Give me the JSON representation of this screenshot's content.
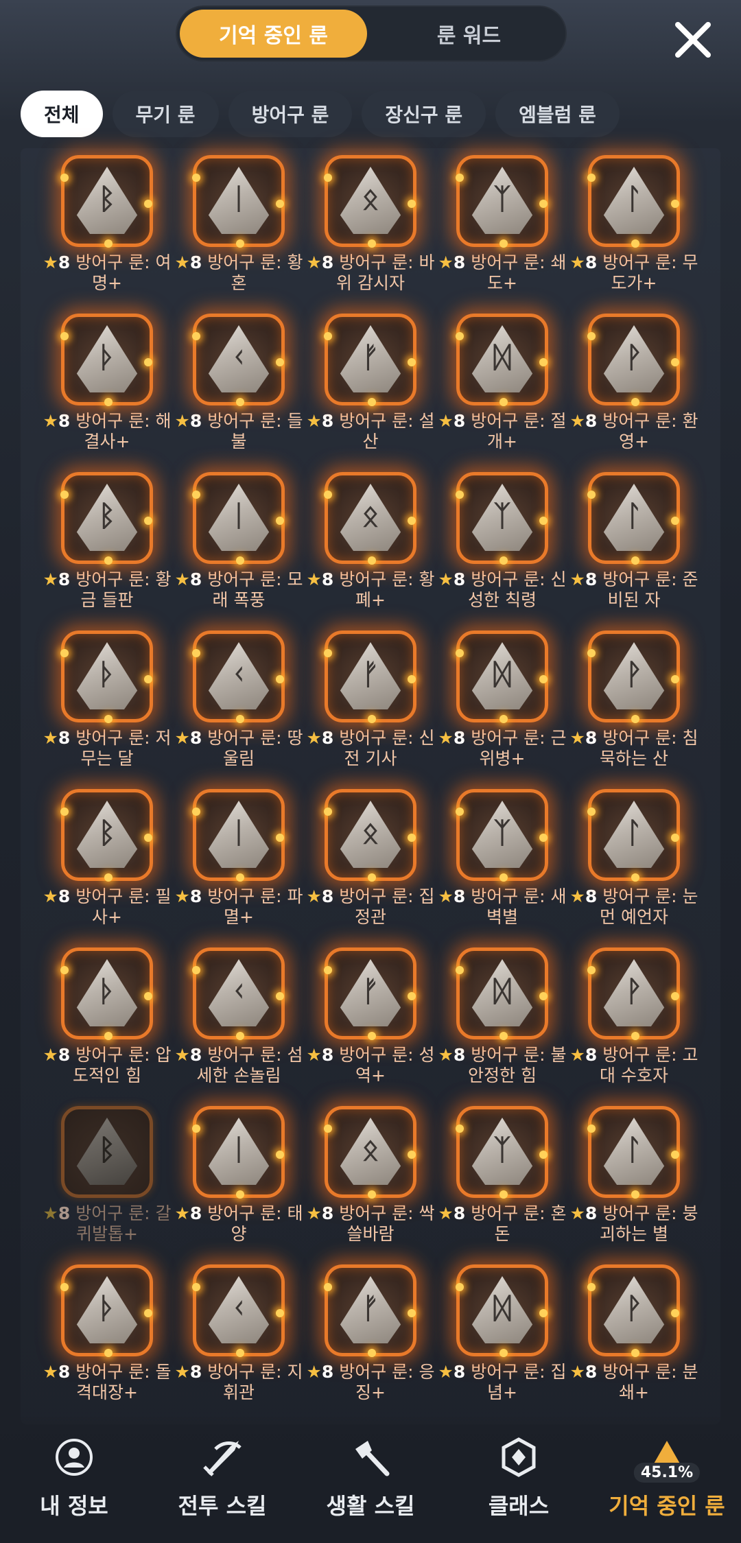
{
  "top_tabs": [
    {
      "label": "기억 중인 룬",
      "active": true
    },
    {
      "label": "룬 워드",
      "active": false
    }
  ],
  "filters": [
    {
      "label": "전체",
      "active": true
    },
    {
      "label": "무기 룬",
      "active": false
    },
    {
      "label": "방어구 룬",
      "active": false
    },
    {
      "label": "장신구 룬",
      "active": false
    },
    {
      "label": "엠블럼 룬",
      "active": false
    }
  ],
  "runes": [
    {
      "level": "8",
      "name": "방어구 룬: 여명+",
      "glyph": "ᛒ",
      "dim": false
    },
    {
      "level": "8",
      "name": "방어구 룬: 황혼",
      "glyph": "ᛁ",
      "dim": false
    },
    {
      "level": "8",
      "name": "방어구 룬: 바위 감시자",
      "glyph": "ᛟ",
      "dim": false
    },
    {
      "level": "8",
      "name": "방어구 룬: 쇄도+",
      "glyph": "ᛉ",
      "dim": false
    },
    {
      "level": "8",
      "name": "방어구 룬: 무도가+",
      "glyph": "ᛚ",
      "dim": false
    },
    {
      "level": "8",
      "name": "방어구 룬: 해결사+",
      "glyph": "ᚦ",
      "dim": false
    },
    {
      "level": "8",
      "name": "방어구 룬: 들불",
      "glyph": "ᚲ",
      "dim": false
    },
    {
      "level": "8",
      "name": "방어구 룬: 설산",
      "glyph": "ᚠ",
      "dim": false
    },
    {
      "level": "8",
      "name": "방어구 룬: 절개+",
      "glyph": "ᛞ",
      "dim": false
    },
    {
      "level": "8",
      "name": "방어구 룬: 환영+",
      "glyph": "ᚹ",
      "dim": false
    },
    {
      "level": "8",
      "name": "방어구 룬: 황금 들판",
      "glyph": "ᛒ",
      "dim": false
    },
    {
      "level": "8",
      "name": "방어구 룬: 모래 폭풍",
      "glyph": "ᛁ",
      "dim": false
    },
    {
      "level": "8",
      "name": "방어구 룬: 황폐+",
      "glyph": "ᛟ",
      "dim": false
    },
    {
      "level": "8",
      "name": "방어구 룬: 신성한 칙령",
      "glyph": "ᛉ",
      "dim": false
    },
    {
      "level": "8",
      "name": "방어구 룬: 준비된 자",
      "glyph": "ᛚ",
      "dim": false
    },
    {
      "level": "8",
      "name": "방어구 룬: 저무는 달",
      "glyph": "ᚦ",
      "dim": false
    },
    {
      "level": "8",
      "name": "방어구 룬: 땅울림",
      "glyph": "ᚲ",
      "dim": false
    },
    {
      "level": "8",
      "name": "방어구 룬: 신전 기사",
      "glyph": "ᚠ",
      "dim": false
    },
    {
      "level": "8",
      "name": "방어구 룬: 근위병+",
      "glyph": "ᛞ",
      "dim": false
    },
    {
      "level": "8",
      "name": "방어구 룬: 침묵하는 산",
      "glyph": "ᚹ",
      "dim": false
    },
    {
      "level": "8",
      "name": "방어구 룬: 필사+",
      "glyph": "ᛒ",
      "dim": false
    },
    {
      "level": "8",
      "name": "방어구 룬: 파멸+",
      "glyph": "ᛁ",
      "dim": false
    },
    {
      "level": "8",
      "name": "방어구 룬: 집정관",
      "glyph": "ᛟ",
      "dim": false
    },
    {
      "level": "8",
      "name": "방어구 룬: 새벽별",
      "glyph": "ᛉ",
      "dim": false
    },
    {
      "level": "8",
      "name": "방어구 룬: 눈 먼 예언자",
      "glyph": "ᛚ",
      "dim": false
    },
    {
      "level": "8",
      "name": "방어구 룬: 압도적인 힘",
      "glyph": "ᚦ",
      "dim": false
    },
    {
      "level": "8",
      "name": "방어구 룬: 섬세한 손놀림",
      "glyph": "ᚲ",
      "dim": false
    },
    {
      "level": "8",
      "name": "방어구 룬: 성역+",
      "glyph": "ᚠ",
      "dim": false
    },
    {
      "level": "8",
      "name": "방어구 룬: 불안정한 힘",
      "glyph": "ᛞ",
      "dim": false
    },
    {
      "level": "8",
      "name": "방어구 룬: 고대 수호자",
      "glyph": "ᚹ",
      "dim": false
    },
    {
      "level": "8",
      "name": "방어구 룬: 갈퀴발톱+",
      "glyph": "ᛒ",
      "dim": true
    },
    {
      "level": "8",
      "name": "방어구 룬: 태양",
      "glyph": "ᛁ",
      "dim": false
    },
    {
      "level": "8",
      "name": "방어구 룬: 싹쓸바람",
      "glyph": "ᛟ",
      "dim": false
    },
    {
      "level": "8",
      "name": "방어구 룬: 혼돈",
      "glyph": "ᛉ",
      "dim": false
    },
    {
      "level": "8",
      "name": "방어구 룬: 붕괴하는 별",
      "glyph": "ᛚ",
      "dim": false
    },
    {
      "level": "8",
      "name": "방어구 룬: 돌격대장+",
      "glyph": "ᚦ",
      "dim": false
    },
    {
      "level": "8",
      "name": "방어구 룬: 지휘관",
      "glyph": "ᚲ",
      "dim": false
    },
    {
      "level": "8",
      "name": "방어구 룬: 응징+",
      "glyph": "ᚠ",
      "dim": false
    },
    {
      "level": "8",
      "name": "방어구 룬: 집념+",
      "glyph": "ᛞ",
      "dim": false
    },
    {
      "level": "8",
      "name": "방어구 룬: 분쇄+",
      "glyph": "ᚹ",
      "dim": false
    }
  ],
  "bottom_nav": [
    {
      "label": "내 정보",
      "icon": "profile-icon",
      "active": false
    },
    {
      "label": "전투 스킬",
      "icon": "sword-icon",
      "active": false
    },
    {
      "label": "생활 스킬",
      "icon": "axe-icon",
      "active": false
    },
    {
      "label": "클래스",
      "icon": "class-emblem-icon",
      "active": false
    },
    {
      "label": "기억 중인 룬",
      "icon": "rune-memory-icon",
      "active": true,
      "badge": "45.1%"
    }
  ],
  "colors": {
    "accent": "#f0ae3c",
    "rune_glow": "#e97a2a",
    "label": "#f3c7a8"
  }
}
